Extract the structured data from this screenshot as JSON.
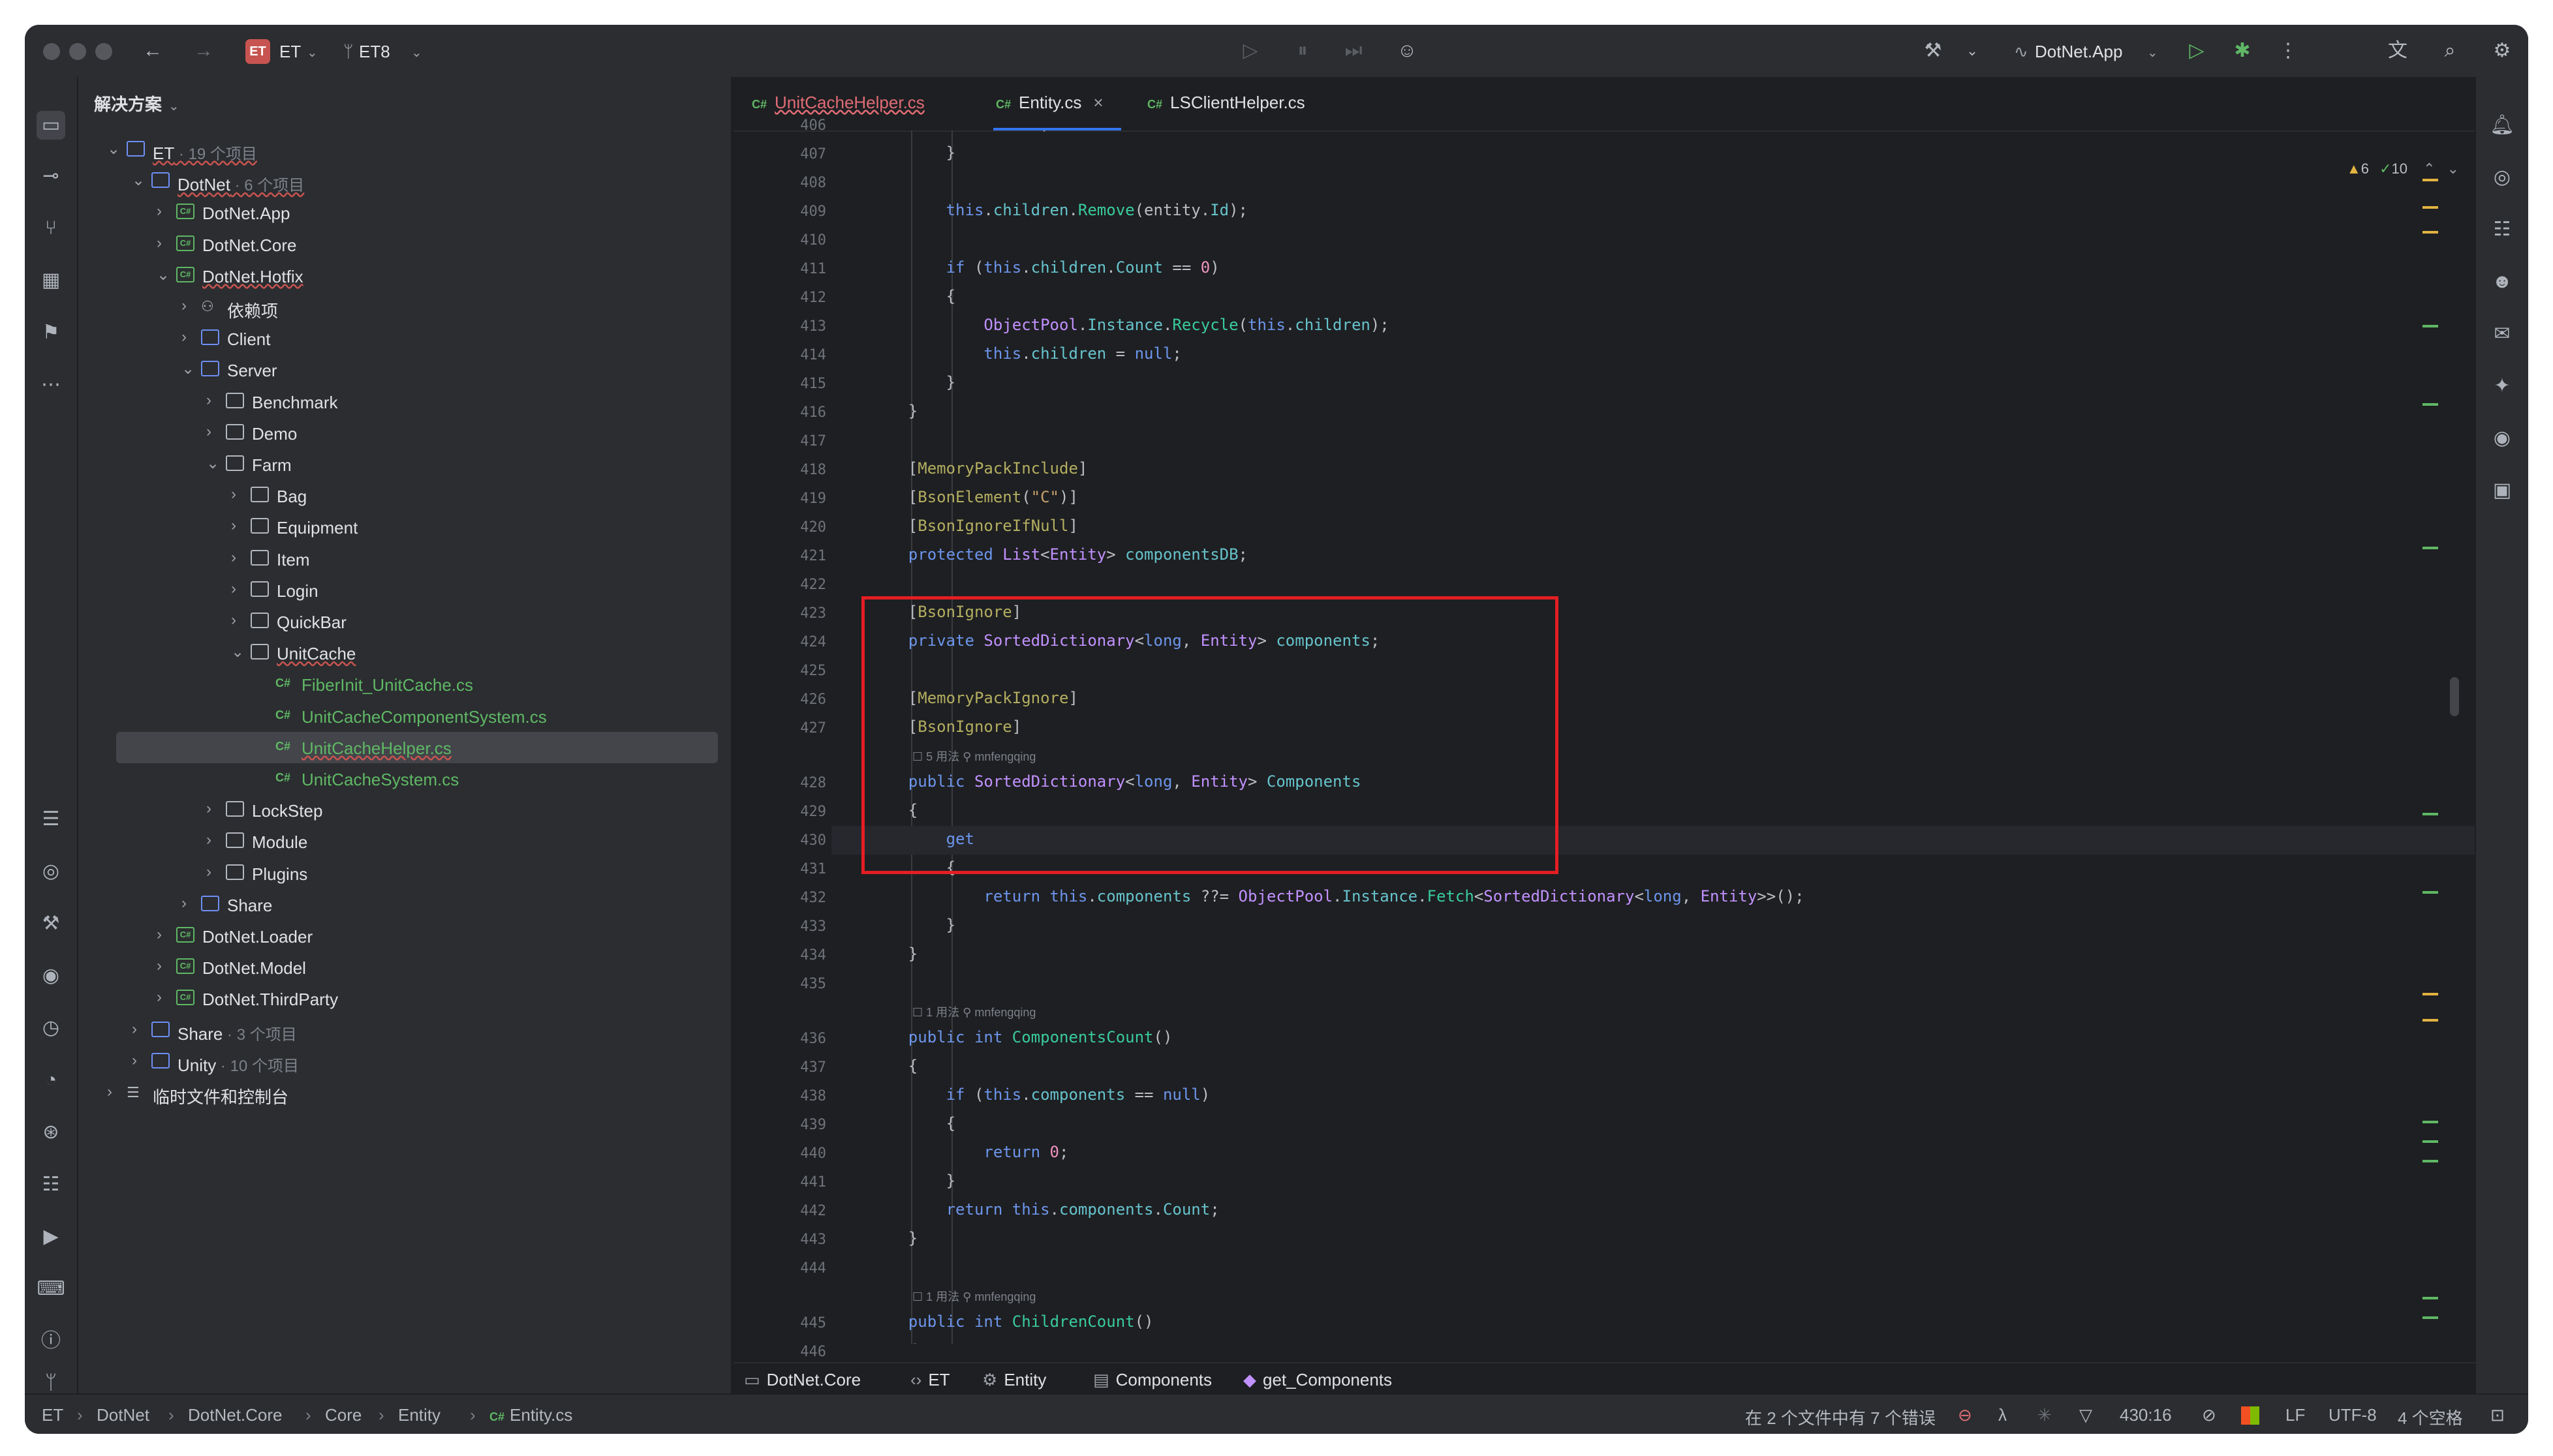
{
  "titlebar": {
    "project_badge": "ET",
    "project_name": "ET",
    "branch": "ET8",
    "run_config": "DotNet.App"
  },
  "project_panel": {
    "title": "解决方案",
    "tree": [
      {
        "label": "ET",
        "meta": " · 19 个项目",
        "depth": 0,
        "icon": "solution",
        "expanded": true,
        "link": true
      },
      {
        "label": "DotNet",
        "meta": " · 6 个项目",
        "depth": 1,
        "icon": "folder-blue",
        "expanded": true,
        "link": true
      },
      {
        "label": "DotNet.App",
        "depth": 2,
        "icon": "csproj",
        "expanded": false
      },
      {
        "label": "DotNet.Core",
        "depth": 2,
        "icon": "csproj",
        "expanded": false
      },
      {
        "label": "DotNet.Hotfix",
        "depth": 2,
        "icon": "csproj",
        "expanded": true,
        "link": true
      },
      {
        "label": "依赖项",
        "depth": 3,
        "icon": "deps",
        "expanded": false
      },
      {
        "label": "Client",
        "depth": 3,
        "icon": "folder-blue",
        "expanded": false
      },
      {
        "label": "Server",
        "depth": 3,
        "icon": "folder-blue",
        "expanded": true
      },
      {
        "label": "Benchmark",
        "depth": 4,
        "icon": "folder",
        "expanded": false
      },
      {
        "label": "Demo",
        "depth": 4,
        "icon": "folder",
        "expanded": false
      },
      {
        "label": "Farm",
        "depth": 4,
        "icon": "folder",
        "expanded": true
      },
      {
        "label": "Bag",
        "depth": 5,
        "icon": "folder",
        "expanded": false
      },
      {
        "label": "Equipment",
        "depth": 5,
        "icon": "folder",
        "expanded": false
      },
      {
        "label": "Item",
        "depth": 5,
        "icon": "folder",
        "expanded": false
      },
      {
        "label": "Login",
        "depth": 5,
        "icon": "folder",
        "expanded": false
      },
      {
        "label": "QuickBar",
        "depth": 5,
        "icon": "folder",
        "expanded": false
      },
      {
        "label": "UnitCache",
        "depth": 5,
        "icon": "folder",
        "expanded": true,
        "link": true
      },
      {
        "label": "FiberInit_UnitCache.cs",
        "depth": 6,
        "icon": "cs",
        "green": true
      },
      {
        "label": "UnitCacheComponentSystem.cs",
        "depth": 6,
        "icon": "cs",
        "green": true
      },
      {
        "label": "UnitCacheHelper.cs",
        "depth": 6,
        "icon": "cs",
        "green": true,
        "selected": true,
        "link": true
      },
      {
        "label": "UnitCacheSystem.cs",
        "depth": 6,
        "icon": "cs",
        "green": true
      },
      {
        "label": "LockStep",
        "depth": 4,
        "icon": "folder",
        "expanded": false
      },
      {
        "label": "Module",
        "depth": 4,
        "icon": "folder",
        "expanded": false
      },
      {
        "label": "Plugins",
        "depth": 4,
        "icon": "folder",
        "expanded": false
      },
      {
        "label": "Share",
        "depth": 3,
        "icon": "folder-blue",
        "expanded": false
      },
      {
        "label": "DotNet.Loader",
        "depth": 2,
        "icon": "csproj",
        "expanded": false
      },
      {
        "label": "DotNet.Model",
        "depth": 2,
        "icon": "csproj",
        "expanded": false
      },
      {
        "label": "DotNet.ThirdParty",
        "depth": 2,
        "icon": "csproj",
        "expanded": false
      },
      {
        "label": "Share",
        "meta": " · 3 个项目",
        "depth": 1,
        "icon": "folder-blue",
        "expanded": false
      },
      {
        "label": "Unity",
        "meta": " · 10 个项目",
        "depth": 1,
        "icon": "folder-blue",
        "expanded": false
      },
      {
        "label": "临时文件和控制台",
        "depth": 0,
        "icon": "scratch",
        "expanded": false
      }
    ]
  },
  "tabs": [
    {
      "label": "UnitCacheHelper.cs",
      "error": true
    },
    {
      "label": "Entity.cs",
      "active": true,
      "close": "×"
    },
    {
      "label": "LSClientHelper.cs"
    }
  ],
  "inspections": {
    "warnings": "6",
    "ok": "10"
  },
  "code_lines": [
    {
      "n": "406",
      "html": "            <span class='kw'>return</span>;"
    },
    {
      "n": "407",
      "html": "        }"
    },
    {
      "n": "408",
      "html": ""
    },
    {
      "n": "409",
      "html": "        <span class='kw'>this</span>.<span class='fd'>children</span>.<span class='mt'>Remove</span>(entity.<span class='fd'>Id</span>);"
    },
    {
      "n": "410",
      "html": ""
    },
    {
      "n": "411",
      "html": "        <span class='kw'>if</span> (<span class='kw'>this</span>.<span class='fd'>children</span>.<span class='fd'>Count</span> == <span class='nm'>0</span>)"
    },
    {
      "n": "412",
      "html": "        {"
    },
    {
      "n": "413",
      "html": "            <span class='tp'>ObjectPool</span>.<span class='fd'>Instance</span>.<span class='mt'>Recycle</span>(<span class='kw'>this</span>.<span class='fd'>children</span>);"
    },
    {
      "n": "414",
      "html": "            <span class='kw'>this</span>.<span class='fd'>children</span> = <span class='kw'>null</span>;"
    },
    {
      "n": "415",
      "html": "        }"
    },
    {
      "n": "416",
      "html": "    }"
    },
    {
      "n": "417",
      "html": ""
    },
    {
      "n": "418",
      "html": "    [<span class='at'>MemoryPackInclude</span>]"
    },
    {
      "n": "419",
      "html": "    [<span class='at'>BsonElement</span>(<span class='st'>\"C\"</span>)]"
    },
    {
      "n": "420",
      "html": "    [<span class='at'>BsonIgnoreIfNull</span>]"
    },
    {
      "n": "421",
      "html": "    <span class='kw'>protected</span> <span class='tp'>List</span>&lt;<span class='tp'>Entity</span>&gt; <span class='fd'>componentsDB</span>;"
    },
    {
      "n": "422",
      "html": ""
    },
    {
      "n": "423",
      "html": "    [<span class='at'>BsonIgnore</span>]"
    },
    {
      "n": "424",
      "html": "    <span class='kw'>private</span> <span class='tp'>SortedDictionary</span>&lt;<span class='kw'>long</span>, <span class='tp'>Entity</span>&gt; <span class='fd'>components</span>;"
    },
    {
      "n": "425",
      "html": ""
    },
    {
      "n": "426",
      "html": "    [<span class='at'>MemoryPackIgnore</span>]"
    },
    {
      "n": "427",
      "html": "    [<span class='at'>BsonIgnore</span>]"
    },
    {
      "hint": "☐ 5 用法   ⚲ mnfengqing"
    },
    {
      "n": "428",
      "html": "    <span class='kw'>public</span> <span class='tp'>SortedDictionary</span>&lt;<span class='kw'>long</span>, <span class='tp'>Entity</span>&gt; <span class='fd'>Components</span>"
    },
    {
      "n": "429",
      "html": "    {"
    },
    {
      "n": "430",
      "html": "        <span class='kw'>get</span>",
      "current": true
    },
    {
      "n": "431",
      "html": "        {"
    },
    {
      "n": "432",
      "html": "            <span class='kw'>return</span> <span class='kw'>this</span>.<span class='fd'>components</span> ??= <span class='tp'>ObjectPool</span>.<span class='fd'>Instance</span>.<span class='mt'>Fetch</span>&lt;<span class='tp'>SortedDictionary</span>&lt;<span class='kw'>long</span>, <span class='tp'>Entity</span>&gt;&gt;();"
    },
    {
      "n": "433",
      "html": "        }"
    },
    {
      "n": "434",
      "html": "    }"
    },
    {
      "n": "435",
      "html": ""
    },
    {
      "hint": "☐ 1 用法   ⚲ mnfengqing"
    },
    {
      "n": "436",
      "html": "    <span class='kw'>public</span> <span class='kw'>int</span> <span class='mt'>ComponentsCount</span>()"
    },
    {
      "n": "437",
      "html": "    {"
    },
    {
      "n": "438",
      "html": "        <span class='kw'>if</span> (<span class='kw'>this</span>.<span class='fd'>components</span> == <span class='kw'>null</span>)"
    },
    {
      "n": "439",
      "html": "        {"
    },
    {
      "n": "440",
      "html": "            <span class='kw'>return</span> <span class='nm'>0</span>;"
    },
    {
      "n": "441",
      "html": "        }"
    },
    {
      "n": "442",
      "html": "        <span class='kw'>return</span> <span class='kw'>this</span>.<span class='fd'>components</span>.<span class='fd'>Count</span>;"
    },
    {
      "n": "443",
      "html": "    }"
    },
    {
      "n": "444",
      "html": ""
    },
    {
      "hint": "☐ 1 用法   ⚲ mnfengqing"
    },
    {
      "n": "445",
      "html": "    <span class='kw'>public</span> <span class='kw'>int</span> <span class='mt'>ChildrenCount</span>()"
    },
    {
      "n": "446",
      "html": "    {"
    }
  ],
  "breadcrumb": [
    {
      "label": "DotNet.Core",
      "icon": "▭"
    },
    {
      "label": "ET",
      "icon": "‹›"
    },
    {
      "label": "Entity",
      "icon": "⚙"
    },
    {
      "label": "Components",
      "icon": "▤"
    },
    {
      "label": "get_Components",
      "icon": "◆"
    }
  ],
  "status": {
    "path": [
      "ET",
      "DotNet",
      "DotNet.Core",
      "Core",
      "Entity",
      "Entity.cs"
    ],
    "errors": "在 2 个文件中有 7 个错误",
    "position": "430:16",
    "line_ending": "LF",
    "encoding": "UTF-8",
    "indent": "4 个空格"
  }
}
